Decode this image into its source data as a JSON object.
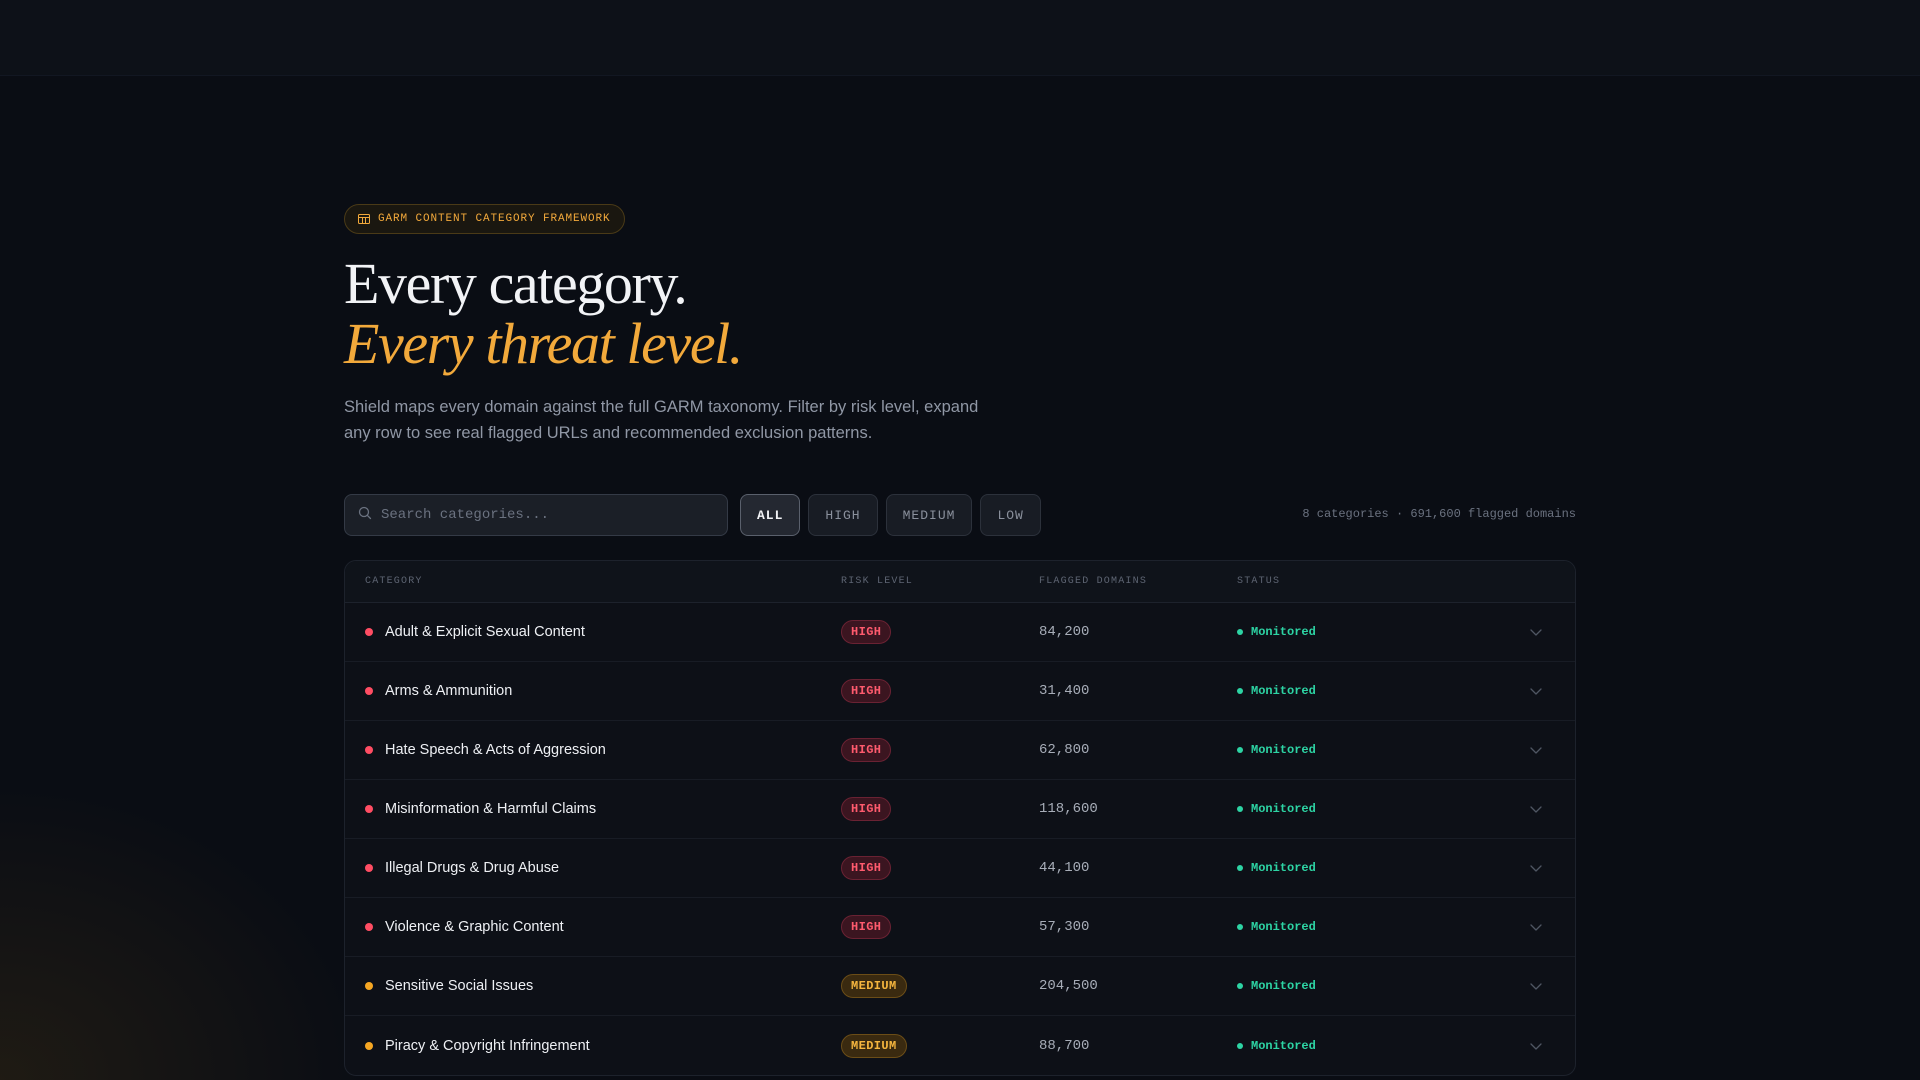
{
  "badge": {
    "icon": "table-icon",
    "text": "GARM CONTENT CATEGORY FRAMEWORK"
  },
  "headline": {
    "line1": "Every category.",
    "line2": "Every threat level."
  },
  "description": "Shield maps every domain against the full GARM taxonomy. Filter by risk level, expand any row to see real flagged URLs and recommended exclusion patterns.",
  "search": {
    "placeholder": "Search categories...",
    "value": ""
  },
  "filters": [
    {
      "label": "ALL",
      "active": true
    },
    {
      "label": "HIGH",
      "active": false
    },
    {
      "label": "MEDIUM",
      "active": false
    },
    {
      "label": "LOW",
      "active": false
    }
  ],
  "summary": "8 categories · 691,600 flagged domains",
  "table": {
    "headers": {
      "category": "CATEGORY",
      "risk": "RISK LEVEL",
      "flagged": "FLAGGED DOMAINS",
      "status": "STATUS"
    },
    "rows": [
      {
        "category": "Adult & Explicit Sexual Content",
        "risk": "HIGH",
        "flagged": "84,200",
        "status": "Monitored"
      },
      {
        "category": "Arms & Ammunition",
        "risk": "HIGH",
        "flagged": "31,400",
        "status": "Monitored"
      },
      {
        "category": "Hate Speech & Acts of Aggression",
        "risk": "HIGH",
        "flagged": "62,800",
        "status": "Monitored"
      },
      {
        "category": "Misinformation & Harmful Claims",
        "risk": "HIGH",
        "flagged": "118,600",
        "status": "Monitored"
      },
      {
        "category": "Illegal Drugs & Drug Abuse",
        "risk": "HIGH",
        "flagged": "44,100",
        "status": "Monitored"
      },
      {
        "category": "Violence & Graphic Content",
        "risk": "HIGH",
        "flagged": "57,300",
        "status": "Monitored"
      },
      {
        "category": "Sensitive Social Issues",
        "risk": "MEDIUM",
        "flagged": "204,500",
        "status": "Monitored"
      },
      {
        "category": "Piracy & Copyright Infringement",
        "risk": "MEDIUM",
        "flagged": "88,700",
        "status": "Monitored"
      }
    ]
  },
  "colors": {
    "accent": "#f2a93b",
    "high": "#ff4d63",
    "medium": "#f5a623",
    "monitored": "#2dd4a4",
    "background": "#0a0d14"
  },
  "icons": {
    "search": "search-icon",
    "expand": "chevron-down-icon",
    "badge": "table-icon"
  }
}
